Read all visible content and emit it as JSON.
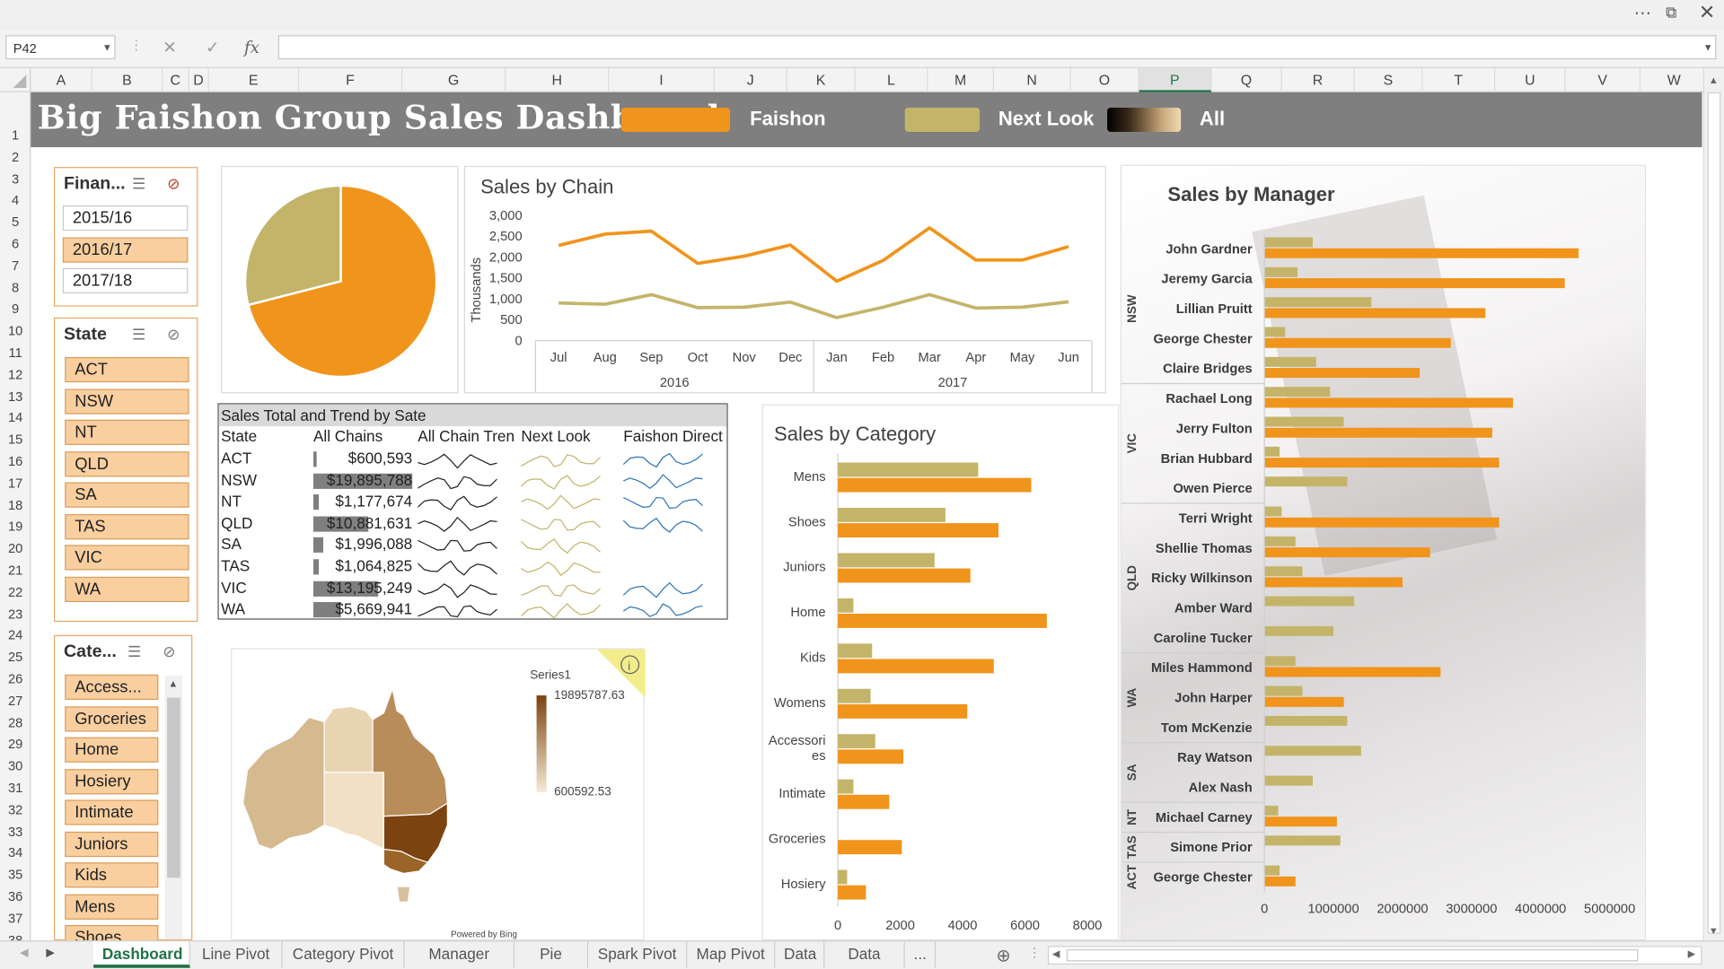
{
  "app": {
    "namebox": "P42",
    "formula": "",
    "columns": [
      {
        "l": "A",
        "s": false
      },
      {
        "l": "B",
        "s": false
      },
      {
        "l": "C",
        "s": false
      },
      {
        "l": "D",
        "s": false
      },
      {
        "l": "E",
        "s": false
      },
      {
        "l": "F",
        "s": false
      },
      {
        "l": "G",
        "s": false
      },
      {
        "l": "H",
        "s": false
      },
      {
        "l": "I",
        "s": false
      },
      {
        "l": "J",
        "s": false
      },
      {
        "l": "K",
        "s": false
      },
      {
        "l": "L",
        "s": false
      },
      {
        "l": "M",
        "s": false
      },
      {
        "l": "N",
        "s": false
      },
      {
        "l": "O",
        "s": false
      },
      {
        "l": "P",
        "s": true
      },
      {
        "l": "Q",
        "s": false
      },
      {
        "l": "R",
        "s": false
      },
      {
        "l": "S",
        "s": false
      },
      {
        "l": "T",
        "s": false
      },
      {
        "l": "U",
        "s": false
      },
      {
        "l": "V",
        "s": false
      },
      {
        "l": "W",
        "s": false
      }
    ],
    "rows": [
      "1",
      "2",
      "3",
      "4",
      "5",
      "6",
      "7",
      "8",
      "9",
      "10",
      "11",
      "12",
      "13",
      "14",
      "15",
      "16",
      "17",
      "18",
      "19",
      "20",
      "21",
      "22",
      "23",
      "24",
      "25",
      "26",
      "27",
      "28",
      "29",
      "30",
      "31",
      "32",
      "33",
      "34",
      "35",
      "36",
      "37",
      "38"
    ],
    "tabs": [
      {
        "label": "Dashboard",
        "active": true
      },
      {
        "label": "Line Pivot",
        "active": false
      },
      {
        "label": "Category Pivot",
        "active": false
      },
      {
        "label": "Manager Pivot",
        "active": false
      },
      {
        "label": "Pie Pivot",
        "active": false
      },
      {
        "label": "Spark Pivot",
        "active": false
      },
      {
        "label": "Map Pivot",
        "active": false
      },
      {
        "label": "Data",
        "active": false
      },
      {
        "label": "Data Aug",
        "active": false
      },
      {
        "label": "...",
        "active": false
      }
    ]
  },
  "banner": {
    "title": "Big Faishon Group Sales Dashboard",
    "legend": [
      {
        "label": "Faishon",
        "color": "#f0941c"
      },
      {
        "label": "Next Look",
        "color": "#c4b46a"
      },
      {
        "label": "All",
        "color": "gradient"
      }
    ]
  },
  "slicers": {
    "financial_year": {
      "title": "Finan...",
      "items": [
        {
          "label": "2015/16",
          "selected": false
        },
        {
          "label": "2016/17",
          "selected": true
        },
        {
          "label": "2017/18",
          "selected": false
        }
      ]
    },
    "state": {
      "title": "State",
      "items": [
        {
          "label": "ACT",
          "selected": true
        },
        {
          "label": "NSW",
          "selected": true
        },
        {
          "label": "NT",
          "selected": true
        },
        {
          "label": "QLD",
          "selected": true
        },
        {
          "label": "SA",
          "selected": true
        },
        {
          "label": "TAS",
          "selected": true
        },
        {
          "label": "VIC",
          "selected": true
        },
        {
          "label": "WA",
          "selected": true
        }
      ]
    },
    "category": {
      "title": "Cate...",
      "items": [
        {
          "label": "Access...",
          "selected": true
        },
        {
          "label": "Groceries",
          "selected": true
        },
        {
          "label": "Home",
          "selected": true
        },
        {
          "label": "Hosiery",
          "selected": true
        },
        {
          "label": "Intimate",
          "selected": true
        },
        {
          "label": "Juniors",
          "selected": true
        },
        {
          "label": "Kids",
          "selected": true
        },
        {
          "label": "Mens",
          "selected": true
        },
        {
          "label": "Shoes",
          "selected": true
        }
      ]
    }
  },
  "sales_table": {
    "title": "Sales Total and Trend by Sate",
    "headers": [
      "State",
      "All Chains",
      "All Chain Tren",
      "Next Look",
      "Faishon Direct"
    ],
    "rows": [
      {
        "state": "ACT",
        "total": "$600,593",
        "bar": 0.03,
        "next_look": true,
        "faishon": true
      },
      {
        "state": "NSW",
        "total": "$19,895,788",
        "bar": 1.0,
        "next_look": true,
        "faishon": true
      },
      {
        "state": "NT",
        "total": "$1,177,674",
        "bar": 0.06,
        "next_look": true,
        "faishon": true
      },
      {
        "state": "QLD",
        "total": "$10,881,631",
        "bar": 0.55,
        "next_look": true,
        "faishon": true
      },
      {
        "state": "SA",
        "total": "$1,996,088",
        "bar": 0.1,
        "next_look": true,
        "faishon": false
      },
      {
        "state": "TAS",
        "total": "$1,064,825",
        "bar": 0.05,
        "next_look": true,
        "faishon": false
      },
      {
        "state": "VIC",
        "total": "$13,195,249",
        "bar": 0.66,
        "next_look": true,
        "faishon": true
      },
      {
        "state": "WA",
        "total": "$5,669,941",
        "bar": 0.28,
        "next_look": true,
        "faishon": true
      }
    ]
  },
  "map": {
    "legend_title": "Series1",
    "max_label": "19895787.63",
    "min_label": "600592.53",
    "credit": "Powered by Bing",
    "info_icon": "info-icon"
  },
  "chart_data": [
    {
      "type": "pie",
      "title": "",
      "series": [
        {
          "name": "Faishon",
          "value": 71,
          "color": "#f0941c"
        },
        {
          "name": "Next Look",
          "value": 29,
          "color": "#c4b46a"
        }
      ]
    },
    {
      "type": "line",
      "title": "Sales by Chain",
      "ylabel": "Thousands",
      "ylim": [
        0,
        3000
      ],
      "yticks": [
        0,
        500,
        1000,
        1500,
        2000,
        2500,
        3000
      ],
      "ytick_labels": [
        "0",
        "500",
        "1,000",
        "1,500",
        "2,000",
        "2,500",
        "3,000"
      ],
      "categories": [
        "Jul",
        "Aug",
        "Sep",
        "Oct",
        "Nov",
        "Dec",
        "Jan",
        "Feb",
        "Mar",
        "Apr",
        "May",
        "Jun"
      ],
      "year_labels": [
        {
          "label": "2016",
          "span": [
            0,
            5
          ]
        },
        {
          "label": "2017",
          "span": [
            6,
            11
          ]
        }
      ],
      "series": [
        {
          "name": "Faishon",
          "color": "#f0941c",
          "values": [
            2280,
            2550,
            2620,
            1850,
            2020,
            2290,
            1420,
            1920,
            2700,
            1930,
            1930,
            2250
          ]
        },
        {
          "name": "Next Look",
          "color": "#c4b46a",
          "values": [
            900,
            870,
            1100,
            790,
            800,
            920,
            550,
            800,
            1100,
            780,
            800,
            930
          ]
        }
      ]
    },
    {
      "type": "bar",
      "orientation": "horizontal",
      "title": "Sales by Category",
      "xlim": [
        0,
        8000
      ],
      "xticks": [
        0,
        2000,
        4000,
        6000,
        8000
      ],
      "categories": [
        "Mens",
        "Shoes",
        "Juniors",
        "Home",
        "Kids",
        "Womens",
        "Accessories",
        "Intimate",
        "Groceries",
        "Hosiery"
      ],
      "series": [
        {
          "name": "Next Look",
          "color": "#c4b46a",
          "values": [
            4500,
            3450,
            3100,
            500,
            1100,
            1050,
            1200,
            500,
            0,
            300
          ]
        },
        {
          "name": "Faishon",
          "color": "#f0941c",
          "values": [
            6200,
            5150,
            4250,
            6700,
            5000,
            4150,
            2100,
            1650,
            2050,
            900
          ]
        }
      ]
    },
    {
      "type": "bar",
      "orientation": "horizontal",
      "title": "Sales by Manager",
      "xlim": [
        0,
        5000000
      ],
      "xticks": [
        0,
        1000000,
        2000000,
        3000000,
        4000000,
        5000000
      ],
      "groups": [
        {
          "label": "NSW",
          "start": 0,
          "count": 5
        },
        {
          "label": "VIC",
          "start": 5,
          "count": 4
        },
        {
          "label": "QLD",
          "start": 9,
          "count": 5
        },
        {
          "label": "WA",
          "start": 14,
          "count": 3
        },
        {
          "label": "SA",
          "start": 17,
          "count": 2
        },
        {
          "label": "NT",
          "start": 19,
          "count": 1
        },
        {
          "label": "TAS",
          "start": 20,
          "count": 1
        },
        {
          "label": "ACT",
          "start": 21,
          "count": 1
        }
      ],
      "categories": [
        "John Gardner",
        "Jeremy Garcia",
        "Lillian Pruitt",
        "George Chester",
        "Claire Bridges",
        "Rachael Long",
        "Jerry Fulton",
        "Brian Hubbard",
        "Owen Pierce",
        "Terri Wright",
        "Shellie Thomas",
        "Ricky Wilkinson",
        "Amber Ward",
        "Caroline Tucker",
        "Miles Hammond",
        "John Harper",
        "Tom McKenzie",
        "Ray Watson",
        "Alex Nash",
        "Michael Carney",
        "Simone Prior",
        "George Chester"
      ],
      "series": [
        {
          "name": "Next Look",
          "color": "#c4b46a",
          "values": [
            700000,
            480000,
            1550000,
            300000,
            750000,
            950000,
            1150000,
            220000,
            1200000,
            250000,
            450000,
            550000,
            1300000,
            1000000,
            450000,
            550000,
            1200000,
            1400000,
            700000,
            200000,
            1100000,
            220000
          ]
        },
        {
          "name": "Faishon",
          "color": "#f0941c",
          "values": [
            4550000,
            4350000,
            3200000,
            2700000,
            2250000,
            3600000,
            3300000,
            3400000,
            0,
            3400000,
            2400000,
            2000000,
            0,
            0,
            2550000,
            1150000,
            0,
            0,
            0,
            1050000,
            0,
            450000
          ]
        }
      ]
    }
  ]
}
